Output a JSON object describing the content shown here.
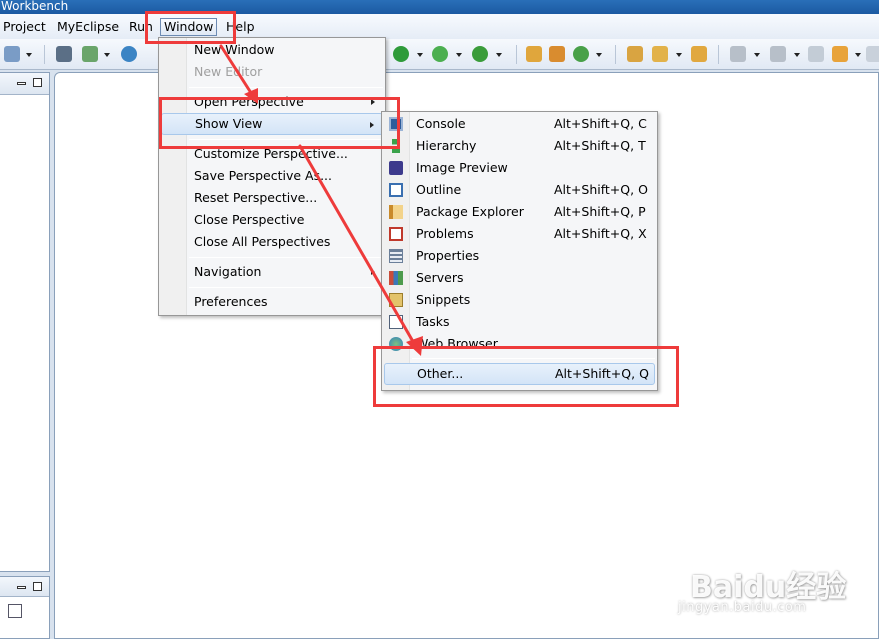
{
  "window": {
    "title": "Workbench"
  },
  "menubar": {
    "items": [
      {
        "label": "Project"
      },
      {
        "label": "MyEclipse"
      },
      {
        "label": "Run"
      },
      {
        "label": "Window",
        "active": true
      },
      {
        "label": "Help"
      }
    ]
  },
  "toolbar": {
    "icons": [
      "web-icon",
      "deploy-icon",
      "server-icon",
      "globe-icon",
      "run-icon",
      "debug-icon",
      "run-external-icon",
      "new-package-icon",
      "new-class-icon",
      "refresh-icon",
      "open-type-icon",
      "pencil-icon",
      "open-folder-icon",
      "next-annotation-icon",
      "prev-annotation-icon",
      "last-edit-icon",
      "back-icon",
      "forward-icon"
    ]
  },
  "window_menu": {
    "items": [
      {
        "label": "New Window",
        "enabled": true
      },
      {
        "label": "New Editor",
        "enabled": false
      },
      {
        "separator": true
      },
      {
        "label": "Open Perspective",
        "submenu": true
      },
      {
        "label": "Show View",
        "submenu": true,
        "highlighted": true
      },
      {
        "separator": true
      },
      {
        "label": "Customize Perspective..."
      },
      {
        "label": "Save Perspective As..."
      },
      {
        "label": "Reset Perspective..."
      },
      {
        "label": "Close Perspective"
      },
      {
        "label": "Close All Perspectives"
      },
      {
        "separator": true
      },
      {
        "label": "Navigation",
        "submenu": true
      },
      {
        "separator": true
      },
      {
        "label": "Preferences"
      }
    ]
  },
  "show_view_menu": {
    "items": [
      {
        "label": "Console",
        "accel": "Alt+Shift+Q, C",
        "icon": "console-icon"
      },
      {
        "label": "Hierarchy",
        "accel": "Alt+Shift+Q, T",
        "icon": "hierarchy-icon"
      },
      {
        "label": "Image Preview",
        "accel": "",
        "icon": "image-preview-icon"
      },
      {
        "label": "Outline",
        "accel": "Alt+Shift+Q, O",
        "icon": "outline-icon"
      },
      {
        "label": "Package Explorer",
        "accel": "Alt+Shift+Q, P",
        "icon": "package-explorer-icon"
      },
      {
        "label": "Problems",
        "accel": "Alt+Shift+Q, X",
        "icon": "problems-icon"
      },
      {
        "label": "Properties",
        "accel": "",
        "icon": "properties-icon"
      },
      {
        "label": "Servers",
        "accel": "",
        "icon": "servers-icon"
      },
      {
        "label": "Snippets",
        "accel": "",
        "icon": "snippets-icon"
      },
      {
        "label": "Tasks",
        "accel": "",
        "icon": "tasks-icon"
      },
      {
        "label": "Web Browser",
        "accel": "",
        "icon": "web-browser-icon"
      },
      {
        "label": "Other...",
        "accel": "Alt+Shift+Q, Q",
        "highlighted": true
      }
    ]
  },
  "watermark": {
    "brand": "Baidu经验",
    "url": "jingyan.baidu.com"
  },
  "colors": {
    "annotation": "#ee3b3b",
    "highlight": "#d3e4f7",
    "titlebar": "#1c5aa2"
  }
}
